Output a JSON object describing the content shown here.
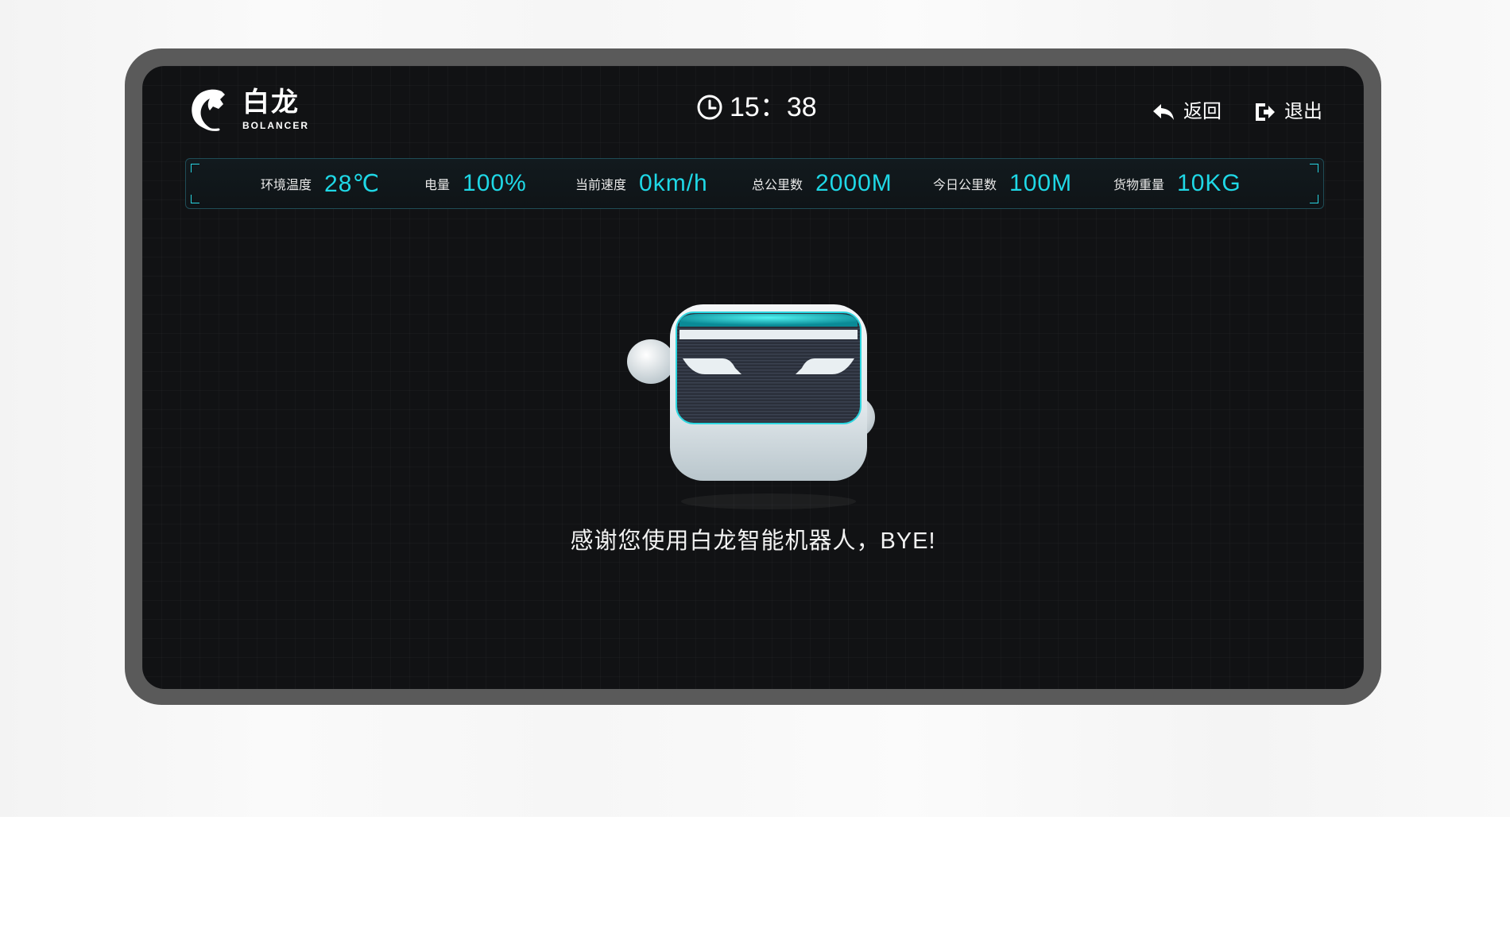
{
  "logo": {
    "name_cn": "白龙",
    "name_en": "BOLANCER"
  },
  "clock": {
    "time": "15：38",
    "icon": "clock-icon"
  },
  "header": {
    "back_label": "返回",
    "back_icon": "reply-arrow-icon",
    "exit_label": "退出",
    "exit_icon": "exit-icon"
  },
  "stats": [
    {
      "label": "环境温度",
      "value": "28℃"
    },
    {
      "label": "电量",
      "value": "100%"
    },
    {
      "label": "当前速度",
      "value": "0km/h"
    },
    {
      "label": "总公里数",
      "value": "2000M"
    },
    {
      "label": "今日公里数",
      "value": "100M"
    },
    {
      "label": "货物重量",
      "value": "10KG"
    }
  ],
  "message": "感谢您使用白龙智能机器人，BYE!",
  "colors": {
    "accent": "#1fd8e6",
    "screen_bg": "#111214",
    "frame": "#5a5a5a"
  }
}
